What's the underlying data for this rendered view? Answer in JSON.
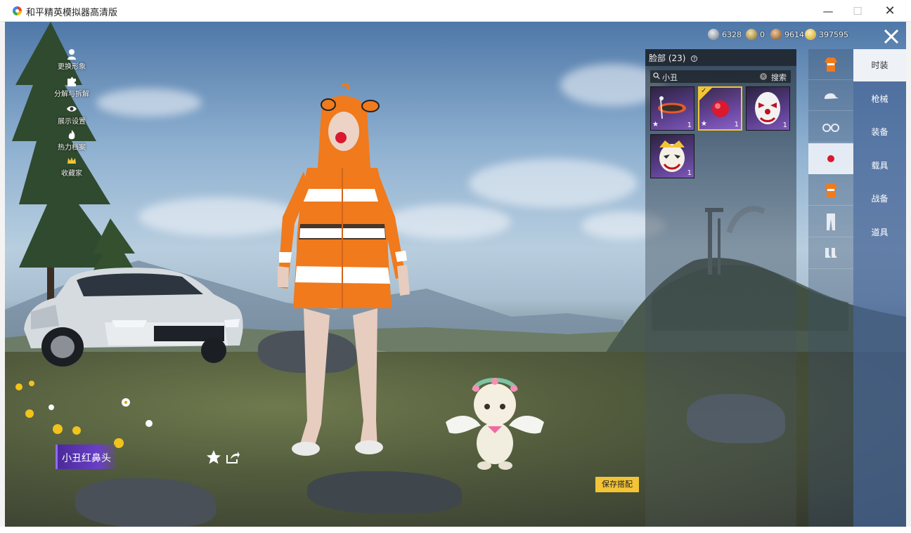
{
  "window": {
    "title": "和平精英模拟器高清版",
    "minimize_glyph": "—",
    "maximize_glyph": "☐",
    "close_glyph": "✕"
  },
  "left_menu": [
    {
      "label": "更换形象",
      "icon": "person-icon"
    },
    {
      "label": "分解与拆解",
      "icon": "puzzle-icon"
    },
    {
      "label": "展示设置",
      "icon": "eye-icon"
    },
    {
      "label": "热力档案",
      "icon": "flame-icon"
    },
    {
      "label": "收藏家",
      "icon": "crown-icon"
    }
  ],
  "currencies": [
    {
      "value": "6328",
      "icon": "silver-coin-icon",
      "color": "#9aa3ad"
    },
    {
      "value": "0",
      "icon": "gold-coupon-icon",
      "color": "#c9a24a"
    },
    {
      "value": "9614",
      "icon": "bronze-coin-icon",
      "color": "#b07a3c"
    },
    {
      "value": "397595",
      "icon": "gold-coin-icon",
      "color": "#e0b53a"
    }
  ],
  "panel": {
    "title": "脸部 (23)",
    "help_glyph": "?",
    "search_value": "小丑",
    "search_button": "搜索",
    "clear_glyph": "×",
    "items": [
      {
        "name": "snorkel-mask",
        "qty": "1",
        "starred": true,
        "selected": false
      },
      {
        "name": "clown-red-nose",
        "qty": "1",
        "starred": true,
        "selected": true
      },
      {
        "name": "clown-face-mask",
        "qty": "1",
        "starred": false,
        "selected": false
      },
      {
        "name": "joker-gold-mask",
        "qty": "1",
        "starred": false,
        "selected": false
      }
    ]
  },
  "categories": [
    {
      "icon": "outfit-icon",
      "active": false
    },
    {
      "icon": "cap-icon",
      "active": false
    },
    {
      "icon": "glasses-icon",
      "active": false
    },
    {
      "icon": "red-nose-icon",
      "active": true
    },
    {
      "icon": "outfit-icon",
      "active": false
    },
    {
      "icon": "pants-icon",
      "active": false
    },
    {
      "icon": "socks-icon",
      "active": false
    }
  ],
  "tabs": [
    {
      "label": "时装",
      "active": true
    },
    {
      "label": "枪械",
      "active": false
    },
    {
      "label": "装备",
      "active": false
    },
    {
      "label": "载具",
      "active": false
    },
    {
      "label": "战备",
      "active": false
    },
    {
      "label": "道具",
      "active": false
    }
  ],
  "selected_item_name": "小丑红鼻头",
  "save_button": "保存搭配",
  "star_glyph": "★",
  "check_glyph": "✓",
  "colors": {
    "accent_gold": "#f3c436",
    "name_plate_purple": "#6a3fc8",
    "item_purple": "#5a3d8a"
  }
}
